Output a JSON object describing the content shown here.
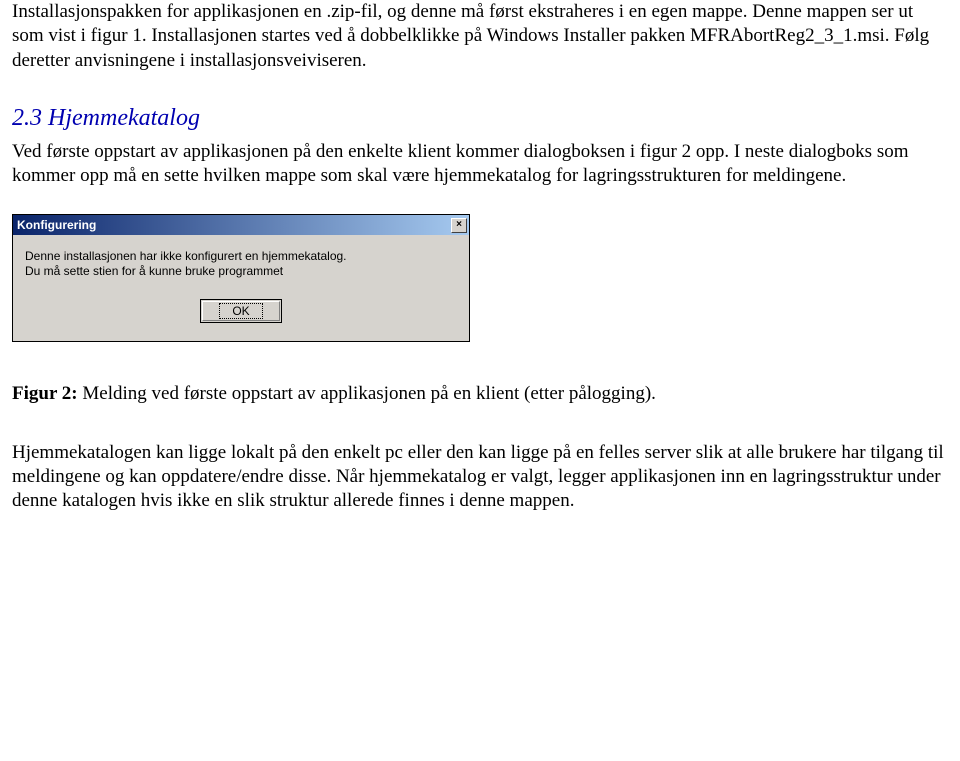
{
  "para1": "Installasjonspakken for applikasjonen en .zip-fil, og denne må først ekstraheres i en egen mappe. Denne mappen ser ut som vist i figur 1. Installasjonen startes ved å dobbelklikke på Windows Installer pakken MFRAbortReg2_3_1.msi. Følg deretter anvisningene i installasjonsveiviseren.",
  "heading": "2.3  Hjemmekatalog",
  "para2": "Ved første oppstart av applikasjonen på den enkelte klient kommer dialogboksen i figur 2 opp. I neste dialogboks som kommer opp må en sette hvilken mappe som skal være hjemmekatalog for lagringsstrukturen for meldingene.",
  "dialog": {
    "title": "Konfigurering",
    "line1": "Denne installasjonen har ikke konfigurert en hjemmekatalog.",
    "line2": "Du må sette stien for å kunne bruke programmet",
    "ok": "OK",
    "close": "×"
  },
  "figcap_label": "Figur 2:",
  "figcap_text": " Melding ved første oppstart av applikasjonen på en klient (etter pålogging).",
  "para3": "Hjemmekatalogen kan ligge lokalt på den enkelt pc eller den kan ligge på en felles server slik at alle brukere har tilgang til meldingene og kan oppdatere/endre disse. Når hjemmekatalog er valgt, legger applikasjonen inn en lagringsstruktur under denne katalogen hvis ikke en slik struktur allerede finnes i denne mappen."
}
